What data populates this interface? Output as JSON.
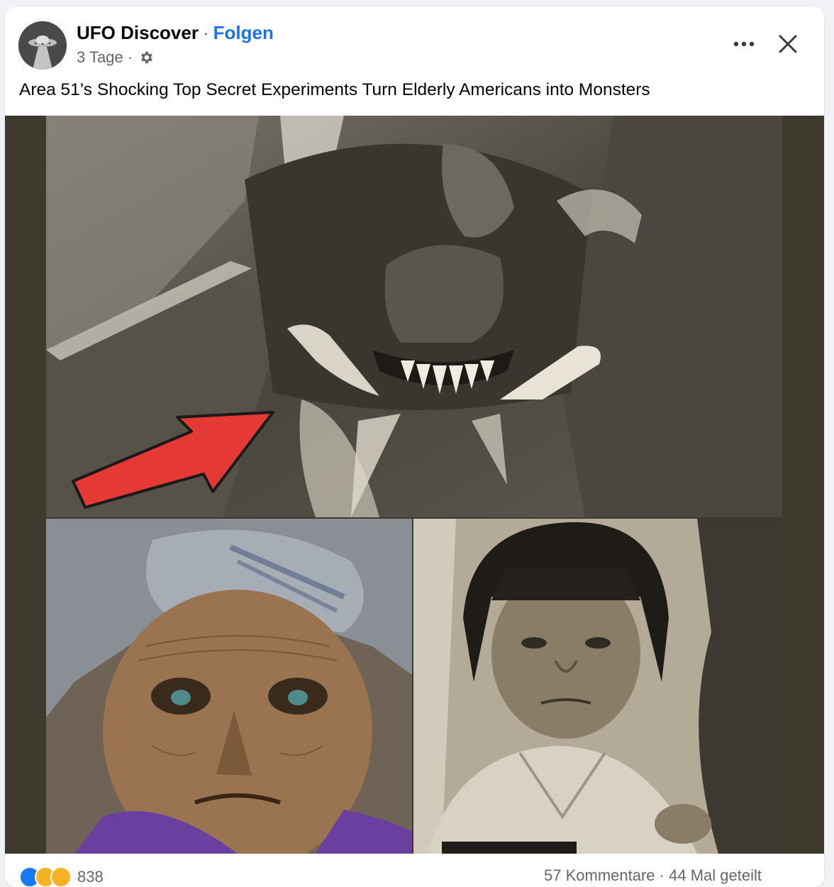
{
  "post": {
    "page_name": "UFO Discover",
    "separator": "·",
    "follow_label": "Folgen",
    "time_label": "3 Tage ·",
    "privacy_icon": "gear-icon",
    "more_icon": "more-horizontal-icon",
    "close_icon": "close-icon",
    "caption": "Area 51’s Shocking Top Secret Experiments Turn Elderly Americans into Monsters"
  },
  "media": {
    "panels": [
      "creature-photo",
      "elderly-person-photo",
      "child-photo"
    ],
    "arrow_color": "#e53935"
  },
  "footer": {
    "reaction_icons": [
      "like-reaction-icon",
      "wow-reaction-icon",
      "haha-reaction-icon"
    ],
    "reaction_count": "838",
    "comments": "57 Kommentare",
    "shares": "44 Mal geteilt",
    "separator": "·"
  },
  "colors": {
    "accent": "#1b74e4",
    "text": "#050505",
    "muted": "#65676b",
    "media_bg": "#3e3a2e"
  }
}
